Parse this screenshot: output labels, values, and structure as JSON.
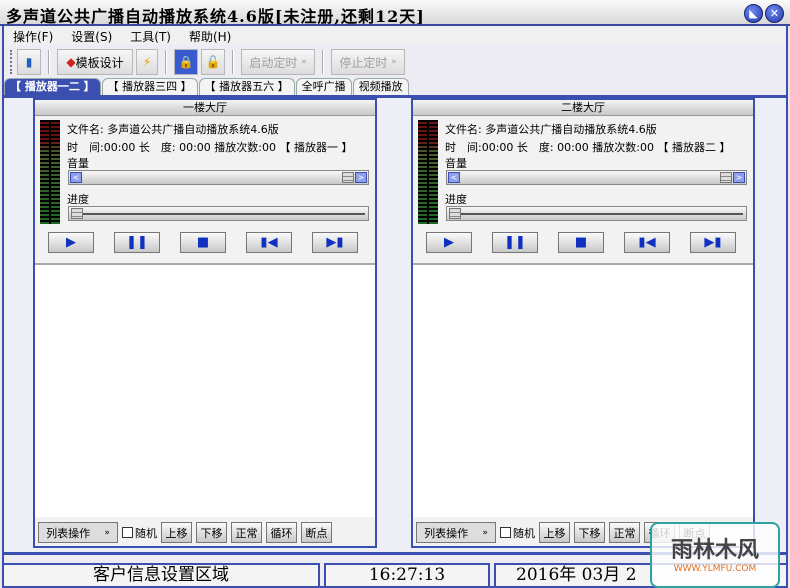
{
  "title": "多声道公共广播自动播放系统4.6版[未注册,还剩12天]",
  "window_buttons": {
    "minimize": "minimize-icon",
    "close": "close-icon"
  },
  "menu": [
    "操作(F)",
    "设置(S)",
    "工具(T)",
    "帮助(H)"
  ],
  "toolbar": {
    "template": "模板设计",
    "start_timer": "启动定时",
    "stop_timer": "停止定时"
  },
  "tabs": [
    "【 播放器一二 】",
    "【 播放器三四 】",
    "【 播放器五六 】",
    "全呼广播",
    "视频播放"
  ],
  "active_tab": 0,
  "panels": [
    {
      "title": "一楼大厅",
      "file": "文件名: 多声道公共广播自动播放系统4.6版",
      "time_line": "时　间:00:00 长　度: 00:00 播放次数:00 【 播放器一 】",
      "volume_label": "音量",
      "progress_label": "进度",
      "volume": 1.0,
      "progress": 0
    },
    {
      "title": "二楼大厅",
      "file": "文件名: 多声道公共广播自动播放系统4.6版",
      "time_line": "时　间:00:00 长　度: 00:00 播放次数:00 【 播放器二 】",
      "volume_label": "音量",
      "progress_label": "进度",
      "volume": 1.0,
      "progress": 0
    }
  ],
  "list_bar": {
    "list_ops": "列表操作",
    "random": "随机",
    "up": "上移",
    "down": "下移",
    "normal": "正常",
    "loop": "循环",
    "breakpoint": "断点"
  },
  "status": {
    "client_info": "客户信息设置区域",
    "time": "16:27:13",
    "date": "2016年 03月 2"
  },
  "watermark": {
    "text": "雨林木风",
    "url": "WWW.YLMFU.COM"
  },
  "colors": {
    "accent": "#3a4fb0"
  }
}
